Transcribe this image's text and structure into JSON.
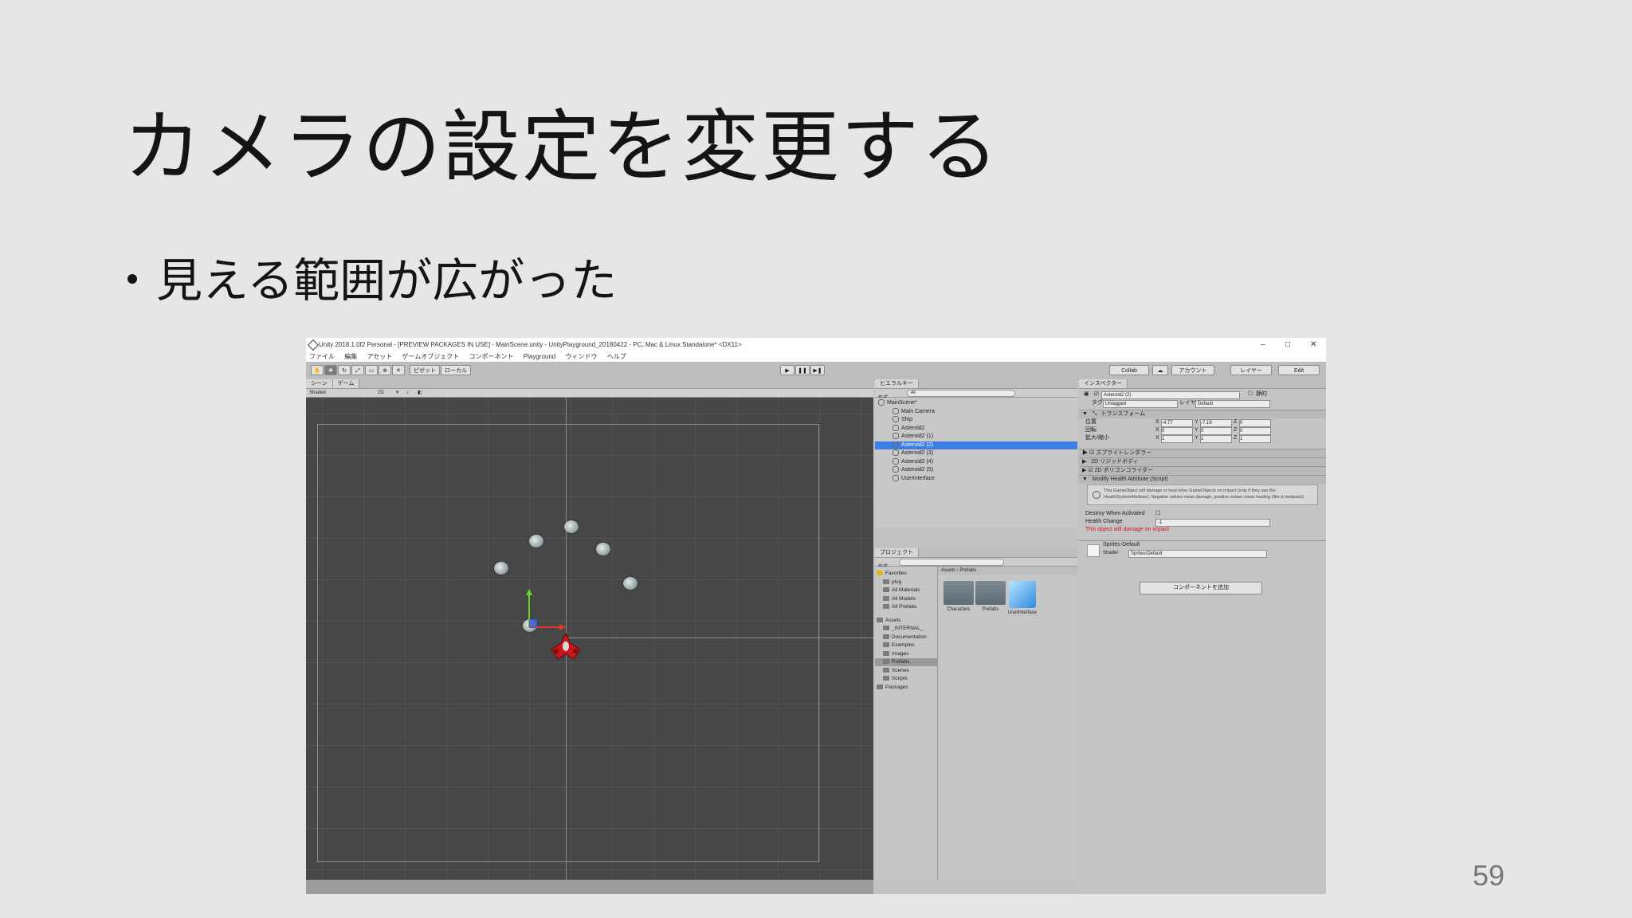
{
  "slide": {
    "title": "カメラの設定を変更する",
    "bullet": "見える範囲が広がった",
    "page_number": "59"
  },
  "unity": {
    "window_title": "Unity 2018.1.0f2 Personal - [PREVIEW PACKAGES IN USE] - MainScene.unity - UnityPlayground_20180422 - PC, Mac & Linux Standalone* <DX11>",
    "window_controls": [
      "–",
      "□",
      "✕"
    ],
    "menu": [
      "ファイル",
      "編集",
      "アセット",
      "ゲームオブジェクト",
      "コンポーネント",
      "Playground",
      "ウィンドウ",
      "ヘルプ"
    ],
    "toolbar": {
      "pivot": "ピボット",
      "local": "ローカル",
      "collab": "Collab",
      "account": "アカウント",
      "layers": "レイヤー",
      "layout": "Edit"
    },
    "scene": {
      "tabs": [
        "シーン",
        "ゲーム"
      ],
      "shading": "Shaded",
      "mode_2d": "2D"
    },
    "hierarchy": {
      "tab": "ヒエラルキー",
      "create": "作成",
      "search_placeholder": "All",
      "items": [
        {
          "label": "MainScene*",
          "selected": false
        },
        {
          "label": "Main Camera",
          "selected": false
        },
        {
          "label": "Ship",
          "selected": false
        },
        {
          "label": "Asteroid2",
          "selected": false
        },
        {
          "label": "Asteroid2 (1)",
          "selected": false
        },
        {
          "label": "Asteroid2 (2)",
          "selected": true
        },
        {
          "label": "Asteroid2 (3)",
          "selected": false
        },
        {
          "label": "Asteroid2 (4)",
          "selected": false
        },
        {
          "label": "Asteroid2 (5)",
          "selected": false
        },
        {
          "label": "UserInterface",
          "selected": false
        }
      ]
    },
    "project": {
      "tab": "プロジェクト",
      "create": "作成",
      "breadcrumb": [
        "Assets",
        "Prefabs"
      ],
      "tree": [
        {
          "label": "Favorites",
          "selected": false
        },
        {
          "label": "plug",
          "selected": false
        },
        {
          "label": "All Materials",
          "selected": false
        },
        {
          "label": "All Models",
          "selected": false
        },
        {
          "label": "All Prefabs",
          "selected": false
        },
        {
          "label": "Assets",
          "selected": false
        },
        {
          "label": "_INTERNAL_",
          "selected": false
        },
        {
          "label": "Documentation",
          "selected": false
        },
        {
          "label": "Examples",
          "selected": false
        },
        {
          "label": "Images",
          "selected": false
        },
        {
          "label": "Prefabs",
          "selected": true
        },
        {
          "label": "Scenes",
          "selected": false
        },
        {
          "label": "Scripts",
          "selected": false
        },
        {
          "label": "Packages",
          "selected": false
        }
      ],
      "assets": [
        {
          "label": "Characters",
          "icon": "folder"
        },
        {
          "label": "Prefabs",
          "icon": "folder"
        },
        {
          "label": "UserInterface",
          "icon": "prefab-cube"
        }
      ]
    },
    "inspector": {
      "tab": "インスペクター",
      "object_name": "Asteroid2 (2)",
      "static_label": "静的",
      "tag_label": "タグ",
      "tag_value": "Untagged",
      "layer_label": "レイヤー",
      "layer_value": "Default",
      "transform": {
        "title": "トランスフォーム",
        "position_label": "位置",
        "rotation_label": "回転",
        "scale_label": "拡大/縮小",
        "position": {
          "x": "-4.77",
          "y": "-7.19",
          "z": "0"
        },
        "rotation": {
          "x": "0",
          "y": "0",
          "z": "0"
        },
        "scale": {
          "x": "1",
          "y": "1",
          "z": "1"
        }
      },
      "components": [
        "スプライトレンダラー",
        "2D リジッドボディ",
        "2D ポリゴンコライダー",
        "Modify Health Attribute (Script)"
      ],
      "help_text": "This GameObject will damage or heal other GameObjects on impact (only if they use the HealthSystemAttribute). Negative values mean damage, positive values mean healing (like a medpack).",
      "destroy_label": "Destroy When Activated",
      "health_label": "Health Change",
      "health_value": "-1",
      "warning": "This object will damage on impact",
      "material_name": "Sprites-Default",
      "shader_label": "Shader",
      "shader_value": "Sprites/Default",
      "add_component": "コンポーネントを追加"
    },
    "colors": {
      "selection": "#3e7de2",
      "scene_bg": "#474747",
      "warning": "#d01818"
    }
  }
}
